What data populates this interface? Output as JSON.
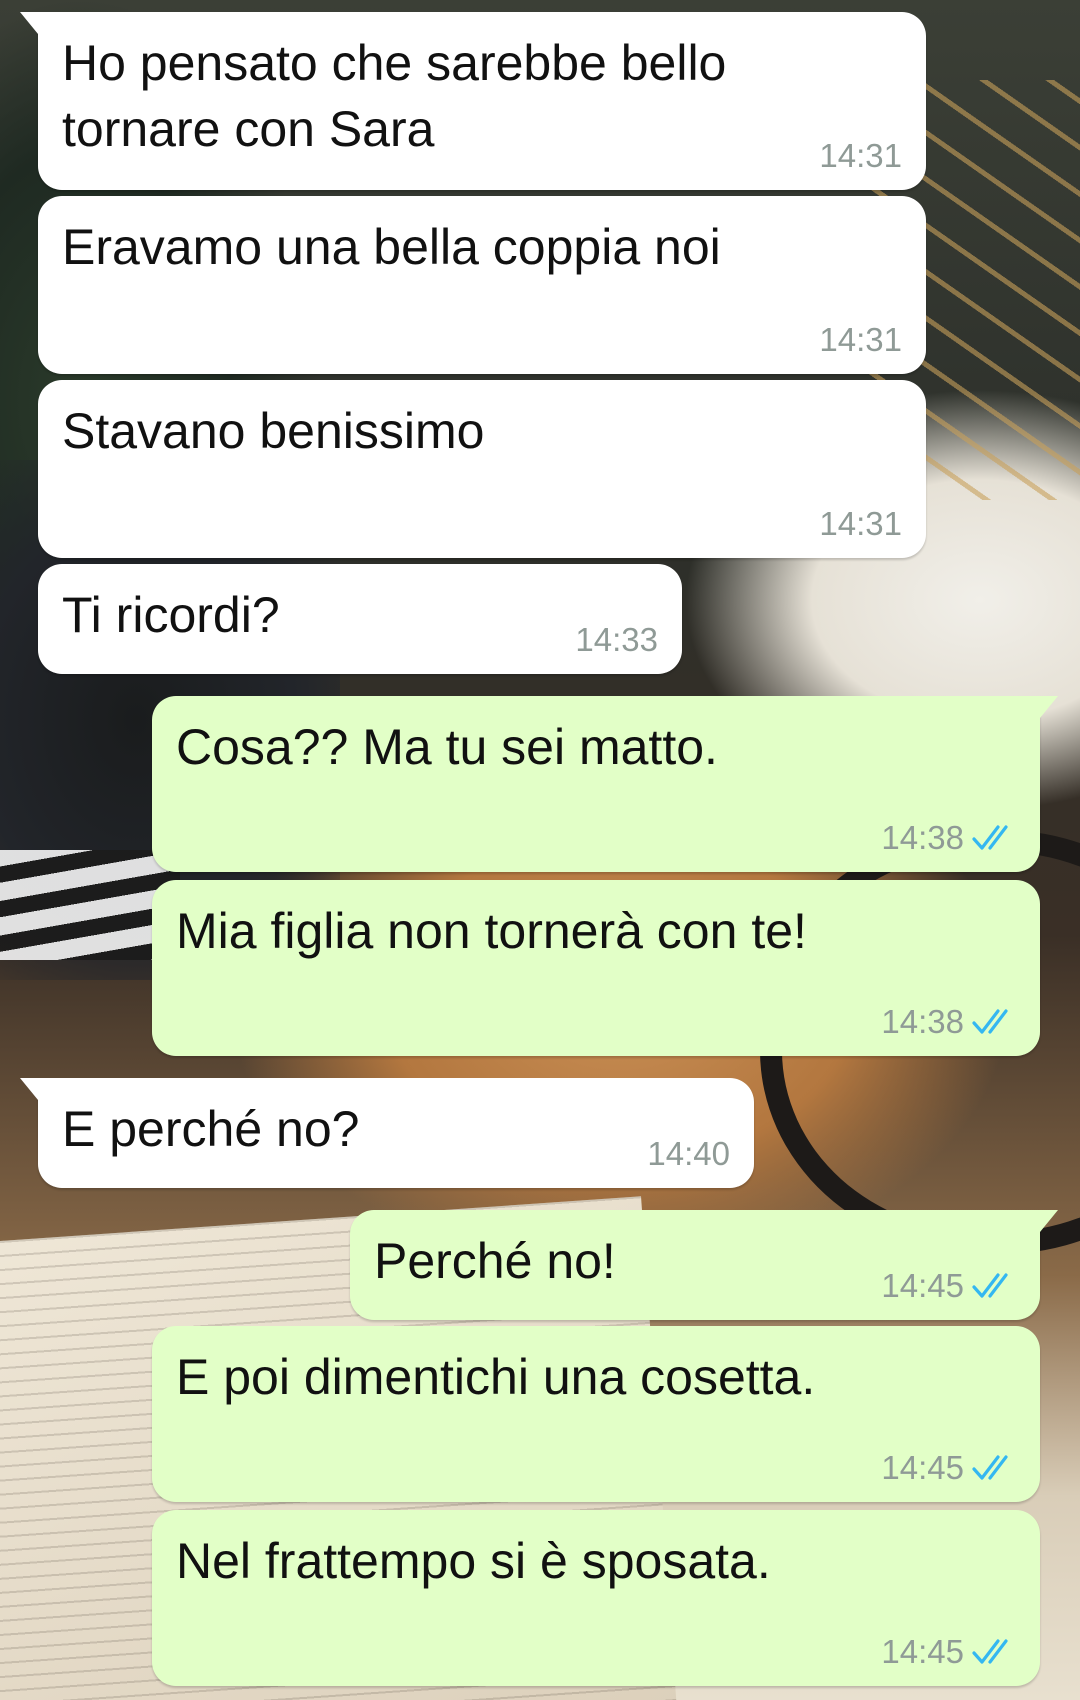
{
  "theme": {
    "incoming_bubble": "#ffffff",
    "outgoing_bubble": "#e2ffc7",
    "read_tick_color": "#34b7f1",
    "timestamp_color": "#8f9a96"
  },
  "messages": [
    {
      "direction": "in",
      "text": "Ho pensato che sarebbe bello\ntornare con Sara",
      "time": "14:31"
    },
    {
      "direction": "in",
      "text": "Eravamo una bella coppia noi",
      "time": "14:31"
    },
    {
      "direction": "in",
      "text": "Stavano benissimo",
      "time": "14:31"
    },
    {
      "direction": "in",
      "text": "Ti ricordi?",
      "time": "14:33"
    },
    {
      "direction": "out",
      "text": "Cosa?? Ma tu sei matto.",
      "time": "14:38",
      "status": "read"
    },
    {
      "direction": "out",
      "text": "Mia figlia non tornerà con te!",
      "time": "14:38",
      "status": "read"
    },
    {
      "direction": "in",
      "text": "E perché no?",
      "time": "14:40"
    },
    {
      "direction": "out",
      "text": "Perché no!",
      "time": "14:45",
      "status": "read"
    },
    {
      "direction": "out",
      "text": "E poi dimentichi una cosetta.",
      "time": "14:45",
      "status": "read"
    },
    {
      "direction": "out",
      "text": "Nel frattempo si è sposata.",
      "time": "14:45",
      "status": "read"
    }
  ]
}
